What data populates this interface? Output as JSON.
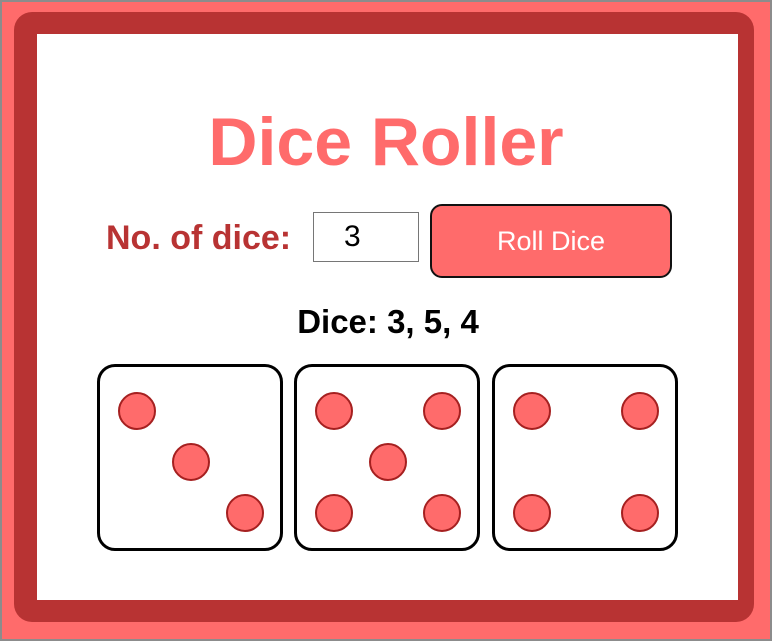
{
  "app": {
    "title": "Dice Roller"
  },
  "controls": {
    "count_label": "No. of dice:",
    "count_value": "3",
    "roll_button_label": "Roll Dice"
  },
  "result": {
    "prefix": "Dice:",
    "values_text": "3, 5, 4"
  },
  "dice": [
    {
      "face": 3
    },
    {
      "face": 5
    },
    {
      "face": 4
    }
  ],
  "colors": {
    "accent": "#ff6b6b",
    "accent_dark": "#b83333",
    "pip_border": "#a52020"
  }
}
